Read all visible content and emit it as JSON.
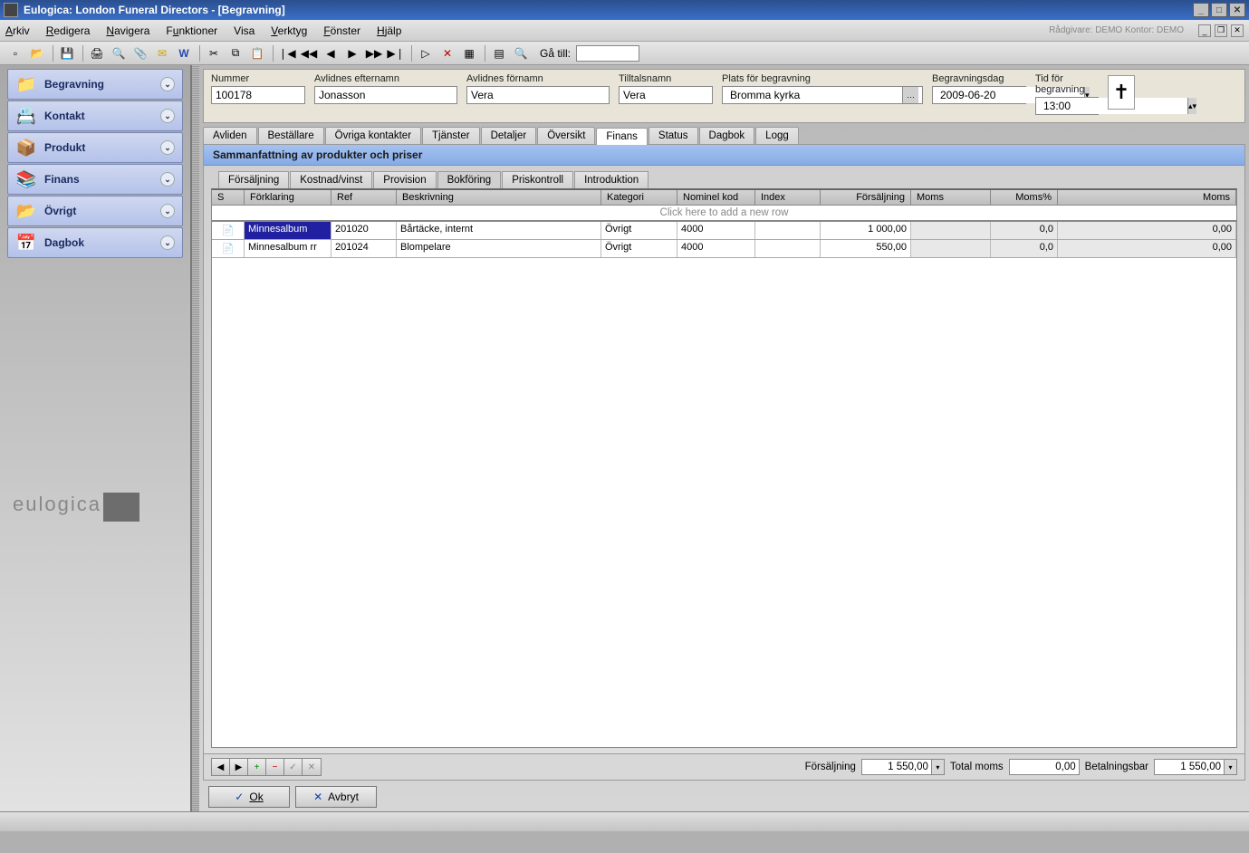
{
  "titlebar": "Eulogica: London Funeral Directors - [Begravning]",
  "menu": {
    "arkiv": "Arkiv",
    "redigera": "Redigera",
    "navigera": "Navigera",
    "funktioner": "Funktioner",
    "visa": "Visa",
    "verktyg": "Verktyg",
    "fonster": "Fönster",
    "hjalp": "Hjälp"
  },
  "menu_status": "Rådgivare: DEMO   Kontor: DEMO",
  "toolbar_goto_label": "Gå till:",
  "sidebar": [
    "Begravning",
    "Kontakt",
    "Produkt",
    "Finans",
    "Övrigt",
    "Dagbok"
  ],
  "sidebar_logo": "eulogica",
  "header_fields": {
    "nummer_label": "Nummer",
    "nummer_value": "100178",
    "efternamn_label": "Avlidnes efternamn",
    "efternamn_value": "Jonasson",
    "fornamn_label": "Avlidnes förnamn",
    "fornamn_value": "Vera",
    "tilltals_label": "Tilltalsnamn",
    "tilltals_value": "Vera",
    "plats_label": "Plats för begravning",
    "plats_value": "Bromma kyrka",
    "dag_label": "Begravningsdag",
    "dag_value": "2009-06-20",
    "tid_label": "Tid för begravning",
    "tid_value": "13:00"
  },
  "main_tabs": [
    "Avliden",
    "Beställare",
    "Övriga kontakter",
    "Tjänster",
    "Detaljer",
    "Översikt",
    "Finans",
    "Status",
    "Dagbok",
    "Logg"
  ],
  "main_tabs_active": 6,
  "section_title": "Sammanfattning av produkter och priser",
  "sub_tabs": [
    "Försäljning",
    "Kostnad/vinst",
    "Provision",
    "Bokföring",
    "Priskontroll",
    "Introduktion"
  ],
  "sub_tabs_active": 3,
  "grid_columns": [
    "S",
    "Förklaring",
    "Ref",
    "Beskrivning",
    "Kategori",
    "Nominel kod",
    "Index",
    "Försäljning",
    "Moms",
    "Moms%",
    "Moms"
  ],
  "grid_add_hint": "Click here to add a new row",
  "grid_rows": [
    {
      "forklaring": "Minnesalbum",
      "ref": "201020",
      "beskrivning": "Bårtäcke, internt",
      "kategori": "Övrigt",
      "nominel": "4000",
      "index": "",
      "forsaljning": "1 000,00",
      "moms": "",
      "momsp": "0,0",
      "moms2": "0,00",
      "selected": true
    },
    {
      "forklaring": "Minnesalbum rr",
      "ref": "201024",
      "beskrivning": "Blompelare",
      "kategori": "Övrigt",
      "nominel": "4000",
      "index": "",
      "forsaljning": "550,00",
      "moms": "",
      "momsp": "0,0",
      "moms2": "0,00",
      "selected": false
    }
  ],
  "grid_footer": {
    "forsaljning_label": "Försäljning",
    "forsaljning_value": "1 550,00",
    "totalmoms_label": "Total moms",
    "totalmoms_value": "0,00",
    "betal_label": "Betalningsbar",
    "betal_value": "1 550,00"
  },
  "actions": {
    "ok": "Ok",
    "cancel": "Avbryt"
  }
}
